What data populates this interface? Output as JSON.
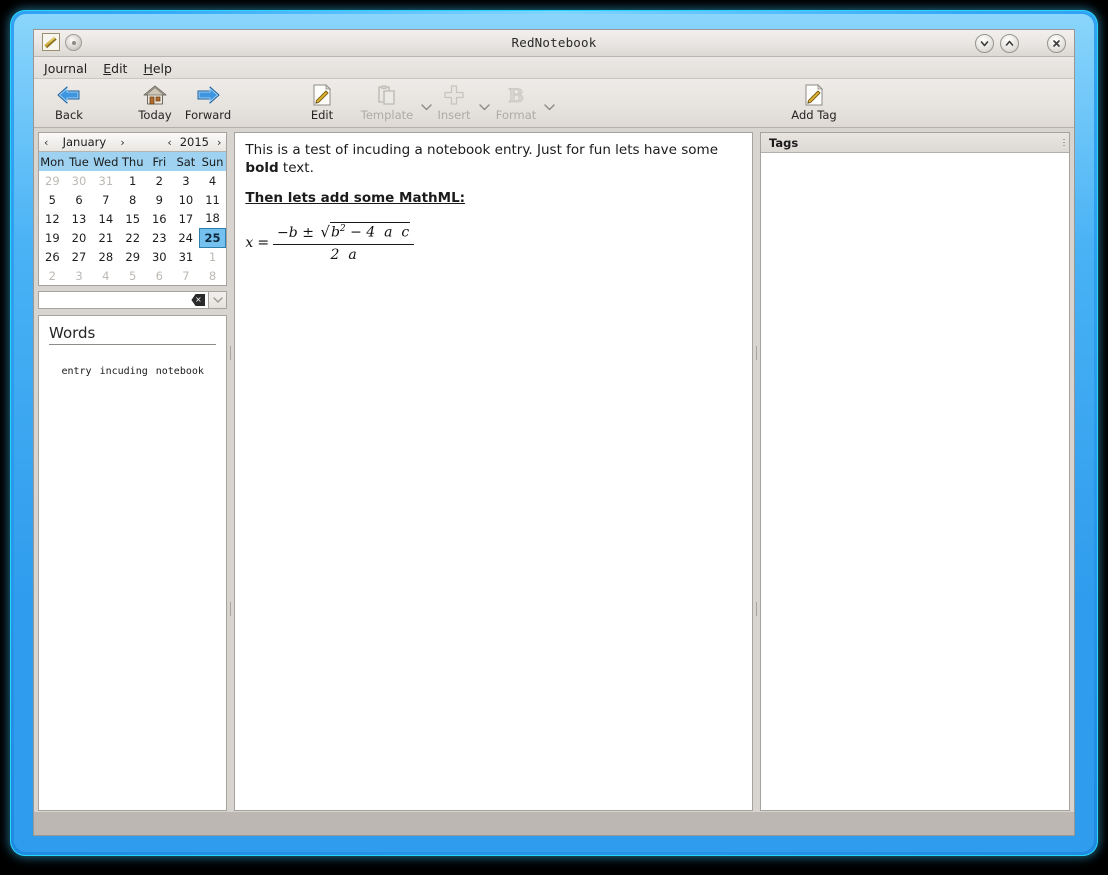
{
  "window": {
    "title": "RedNotebook",
    "icons": {
      "app": "notebook-pencil-icon",
      "secondary": "record-dot-icon"
    },
    "controls": {
      "minimize": "minimize-button",
      "maximize": "maximize-button",
      "close": "close-button"
    }
  },
  "menubar": {
    "items": [
      {
        "mnemonic": "J",
        "rest": "ournal"
      },
      {
        "mnemonic": "E",
        "rest": "dit"
      },
      {
        "mnemonic": "H",
        "rest": "elp"
      }
    ]
  },
  "toolbar": {
    "items": [
      {
        "label": "Back",
        "icon": "arrow-left-icon",
        "enabled": true,
        "dropdown": false
      },
      {
        "label": "Today",
        "icon": "home-icon",
        "enabled": true,
        "dropdown": false
      },
      {
        "label": "Forward",
        "icon": "arrow-right-icon",
        "enabled": true,
        "dropdown": false
      },
      {
        "label": "Edit",
        "icon": "pencil-page-icon",
        "enabled": true,
        "dropdown": false
      },
      {
        "label": "Template",
        "icon": "clipboard-icon",
        "enabled": false,
        "dropdown": true
      },
      {
        "label": "Insert",
        "icon": "plus-icon",
        "enabled": false,
        "dropdown": true
      },
      {
        "label": "Format",
        "icon": "bold-b-icon",
        "enabled": false,
        "dropdown": true
      },
      {
        "label": "Add Tag",
        "icon": "pencil-page-icon",
        "enabled": true,
        "dropdown": false
      }
    ]
  },
  "calendar": {
    "month": "January",
    "year": "2015",
    "prev_month_label": "‹",
    "next_month_label": "›",
    "prev_year_label": "‹",
    "next_year_label": "›",
    "weekdays": [
      "Mon",
      "Tue",
      "Wed",
      "Thu",
      "Fri",
      "Sat",
      "Sun"
    ],
    "selected_day": "25",
    "weeks": [
      [
        {
          "d": "29",
          "o": true
        },
        {
          "d": "30",
          "o": true
        },
        {
          "d": "31",
          "o": true
        },
        {
          "d": "1"
        },
        {
          "d": "2"
        },
        {
          "d": "3"
        },
        {
          "d": "4"
        }
      ],
      [
        {
          "d": "5"
        },
        {
          "d": "6"
        },
        {
          "d": "7"
        },
        {
          "d": "8"
        },
        {
          "d": "9"
        },
        {
          "d": "10"
        },
        {
          "d": "11"
        }
      ],
      [
        {
          "d": "12"
        },
        {
          "d": "13"
        },
        {
          "d": "14"
        },
        {
          "d": "15"
        },
        {
          "d": "16"
        },
        {
          "d": "17"
        },
        {
          "d": "18"
        }
      ],
      [
        {
          "d": "19"
        },
        {
          "d": "20"
        },
        {
          "d": "21"
        },
        {
          "d": "22"
        },
        {
          "d": "23"
        },
        {
          "d": "24"
        },
        {
          "d": "25",
          "sel": true
        }
      ],
      [
        {
          "d": "26"
        },
        {
          "d": "27"
        },
        {
          "d": "28"
        },
        {
          "d": "29"
        },
        {
          "d": "30"
        },
        {
          "d": "31"
        },
        {
          "d": "1",
          "o": true
        }
      ],
      [
        {
          "d": "2",
          "o": true
        },
        {
          "d": "3",
          "o": true
        },
        {
          "d": "4",
          "o": true
        },
        {
          "d": "5",
          "o": true
        },
        {
          "d": "6",
          "o": true
        },
        {
          "d": "7",
          "o": true
        },
        {
          "d": "8",
          "o": true
        }
      ]
    ]
  },
  "search": {
    "value": "",
    "placeholder": "",
    "clear_icon": "clear-backspace-icon",
    "dropdown_icon": "chevron-down-icon"
  },
  "words_panel": {
    "title": "Words",
    "cloud": [
      "entry",
      "incuding",
      "notebook"
    ]
  },
  "editor": {
    "paragraph_prefix": "This is a test of incuding a notebook entry. Just for fun lets have some ",
    "paragraph_bold": "bold",
    "paragraph_suffix": " text.",
    "heading": "Then lets add some MathML:",
    "formula": {
      "lhs": "x",
      "equals": "=",
      "numerator_prefix": "−b ±",
      "radicand": "b",
      "radicand_exp": "2",
      "radicand_rest": "− 4",
      "radicand_a": "a",
      "radicand_c": "c",
      "denominator": "2",
      "denominator_a": "a",
      "plain": "x = (−b ± √(b² − 4 a c)) / (2 a)"
    }
  },
  "tags_panel": {
    "header": "Tags",
    "items": []
  },
  "colors": {
    "window_chrome": "#d8d4d0",
    "glow_border": "#3aa9f2",
    "calendar_header": "#9ed2f0",
    "selected_day": "#74c0ee",
    "statusbar": "#bdb7b4",
    "disabled_text": "#aeaaa5"
  }
}
